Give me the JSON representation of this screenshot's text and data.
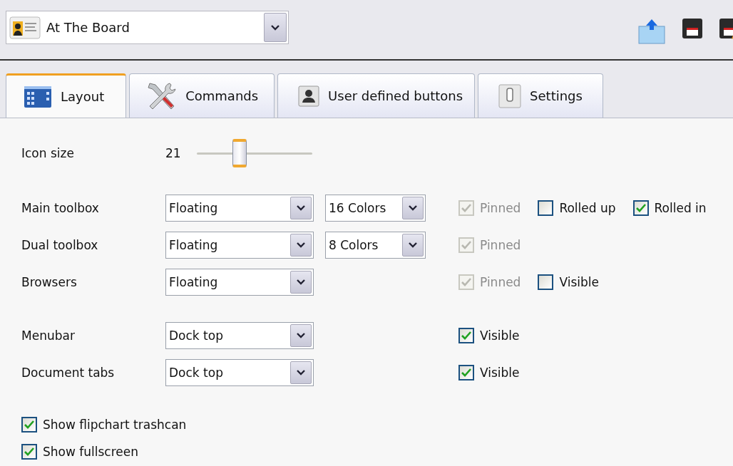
{
  "profile": {
    "value": "At The Board"
  },
  "tabs": [
    {
      "label": "Layout",
      "kind": "layout",
      "selected": true
    },
    {
      "label": "Commands",
      "kind": "commands",
      "selected": false
    },
    {
      "label": "User defined buttons",
      "kind": "user",
      "selected": false
    },
    {
      "label": "Settings",
      "kind": "settings",
      "selected": false
    }
  ],
  "icon_size": {
    "label": "Icon size",
    "reading": "21",
    "level": 0.37
  },
  "toolbox_rows": [
    {
      "label": "Main toolbox",
      "mode": "Floating",
      "colors": "16 Colors",
      "checkboxes": [
        {
          "label": "Pinned",
          "checked": true,
          "disabled": true
        },
        {
          "label": "Rolled up",
          "checked": false,
          "disabled": false
        },
        {
          "label": "Rolled in",
          "checked": true,
          "disabled": false
        }
      ]
    },
    {
      "label": "Dual toolbox",
      "mode": "Floating",
      "colors": "8 Colors",
      "checkboxes": [
        {
          "label": "Pinned",
          "checked": true,
          "disabled": true
        }
      ]
    },
    {
      "label": "Browsers",
      "mode": "Floating",
      "checkboxes": [
        {
          "label": "Pinned",
          "checked": true,
          "disabled": true
        },
        {
          "label": "Visible",
          "checked": false,
          "disabled": false
        }
      ]
    }
  ],
  "dock_rows": [
    {
      "label": "Menubar",
      "mode": "Dock top",
      "checkboxes": [
        {
          "label": "Visible",
          "checked": true,
          "disabled": false
        }
      ]
    },
    {
      "label": "Document tabs",
      "mode": "Dock top",
      "checkboxes": [
        {
          "label": "Visible",
          "checked": true,
          "disabled": false
        }
      ]
    }
  ],
  "options": [
    {
      "label": "Show flipchart trashcan",
      "checked": true
    },
    {
      "label": "Show fullscreen",
      "checked": true
    }
  ]
}
